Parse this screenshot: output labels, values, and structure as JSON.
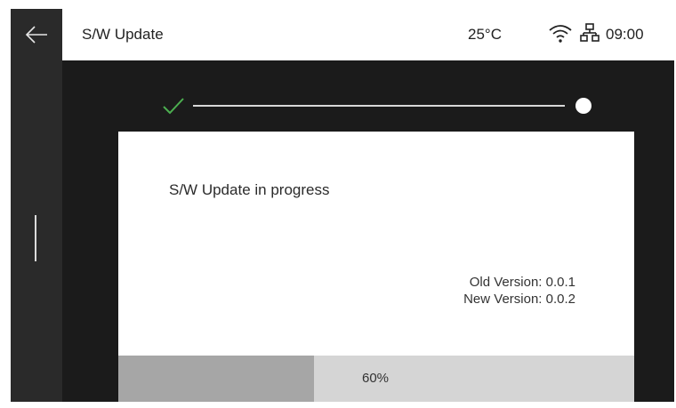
{
  "header": {
    "title": "S/W Update",
    "temperature": "25°C",
    "time": "09:00",
    "back_icon": "arrow-left-icon",
    "status_icons": [
      "wifi-icon",
      "network-icon"
    ]
  },
  "stepper": {
    "steps": [
      {
        "state": "completed",
        "icon": "check-icon"
      },
      {
        "state": "current",
        "icon": "dot-icon"
      }
    ],
    "check_color": "#4caf50"
  },
  "update": {
    "message": "S/W Update in progress",
    "old_version": "Old Version: 0.0.1",
    "new_version": "New Version: 0.0.2",
    "progress_fraction": 0.38,
    "progress_label": "60%"
  },
  "colors": {
    "frame_bg": "#1b1b1b",
    "sidebar_bg": "#2a2a2a",
    "progress_fill": "#a6a6a6",
    "progress_track": "#d5d5d5"
  }
}
